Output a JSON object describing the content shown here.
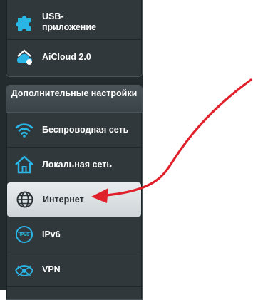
{
  "top_menu": {
    "items": [
      {
        "label": "USB-\nприложение",
        "icon": "puzzle-icon"
      },
      {
        "label": "AiCloud 2.0",
        "icon": "cloud-home-icon"
      }
    ]
  },
  "advanced": {
    "header": "Дополнительные настройки",
    "items": [
      {
        "label": "Беспроводная сеть",
        "icon": "wifi-icon"
      },
      {
        "label": "Локальная сеть",
        "icon": "home-icon"
      },
      {
        "label": "Интернет",
        "icon": "globe-icon",
        "selected": true
      },
      {
        "label": "IPv6",
        "icon": "ipv6-icon"
      },
      {
        "label": "VPN",
        "icon": "vpn-icon"
      }
    ]
  },
  "colors": {
    "panel_bg": "#242b2e",
    "icon_accent": "#29b5e6",
    "arrow": "#e0202a"
  }
}
